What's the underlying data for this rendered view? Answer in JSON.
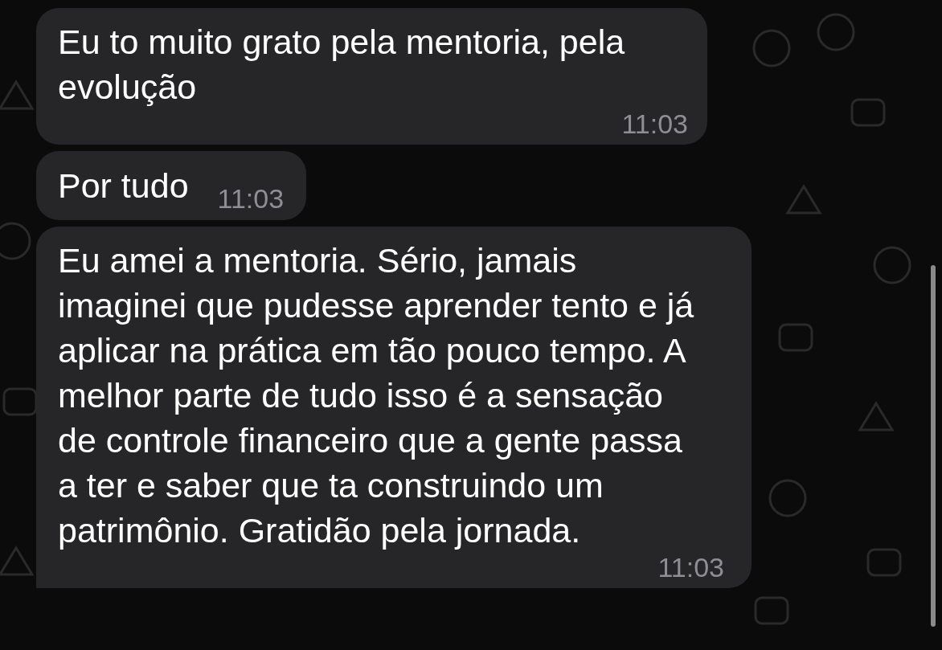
{
  "messages": [
    {
      "kind": "long",
      "text": "Eu to muito grato pela mentoria, pela evolução",
      "time": "11:03",
      "tail": false
    },
    {
      "kind": "short",
      "text": "Por tudo",
      "time": "11:03",
      "tail": false
    },
    {
      "kind": "long",
      "text": "Eu amei a mentoria. Sério, jamais imaginei que pudesse aprender tento e já aplicar na prática em tão pouco tempo. A melhor parte de tudo isso é a sensação de controle financeiro que a gente passa a ter e saber que ta construindo um patrimônio. Gratidão pela jornada.",
      "time": "11:03",
      "tail": true
    }
  ]
}
